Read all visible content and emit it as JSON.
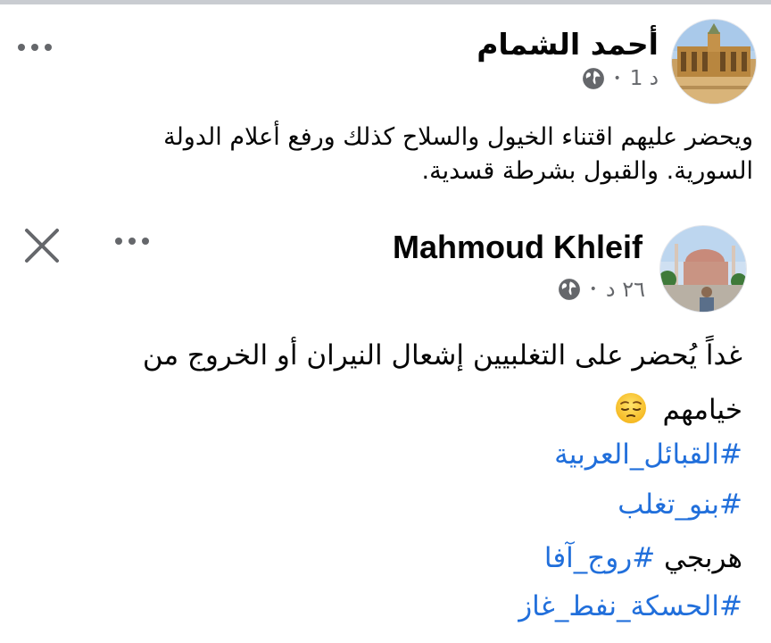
{
  "posts": [
    {
      "author": "أحمد الشمام",
      "time": "1 د",
      "separator": "•",
      "privacy_icon": "globe-icon",
      "menu_icon": "more-icon",
      "avatar_icon": "mosque-courtyard-photo",
      "body_lines": [
        "ويحضر عليهم اقتناء الخيول والسلاح كذلك ورفع أعلام الدولة",
        "السورية. والقبول بشرطة قسدية."
      ]
    },
    {
      "author": "Mahmoud Khleif",
      "time": "٢٦ د",
      "separator": "•",
      "privacy_icon": "globe-icon",
      "menu_icon": "more-icon",
      "close_icon": "close-icon",
      "avatar_icon": "hagia-sophia-photo",
      "body_lines": [
        "غداً يُحضر على التغلبيين إشعال النيران أو الخروج من",
        "خيامهم"
      ],
      "emoji": "pensive-face-emoji",
      "hashtag_lines": [
        {
          "prefix": "",
          "tag": "#القبائل_العربية"
        },
        {
          "prefix": "",
          "tag": "#بنو_تغلب"
        },
        {
          "prefix": "هربجي ",
          "tag": "#روج_آفا"
        },
        {
          "prefix": "",
          "tag": "#الحسكة_نفط_غاز"
        }
      ]
    }
  ],
  "colors": {
    "text": "#050505",
    "meta": "#65676b",
    "hashtag": "#216fdb",
    "divider": "#c9ccd1"
  }
}
